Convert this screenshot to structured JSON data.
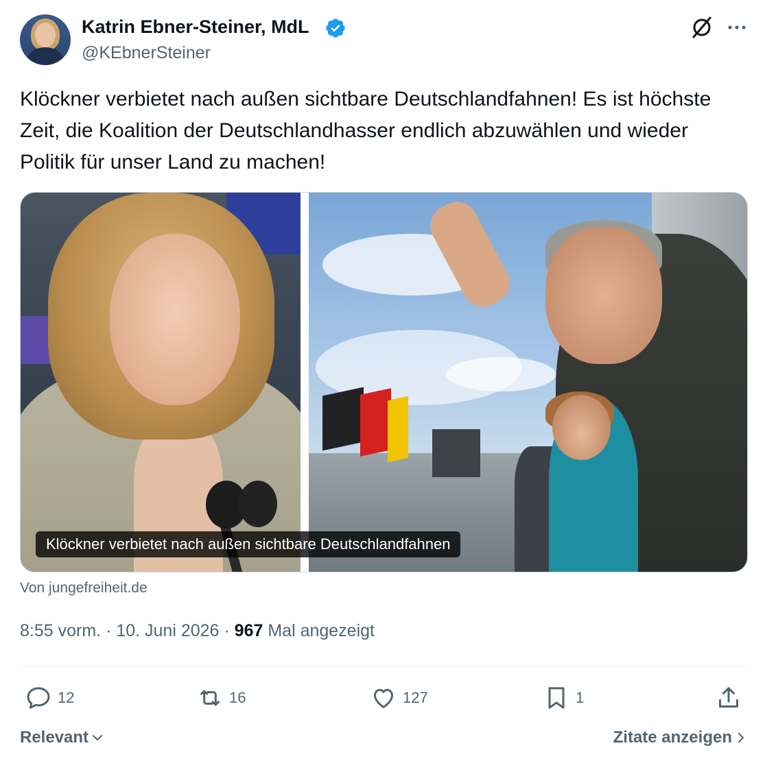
{
  "author": {
    "name": "Katrin Ebner-Steiner, MdL",
    "handle": "@KEbnerSteiner",
    "verified": true
  },
  "tweet": {
    "text": "Klöckner verbietet nach außen sichtbare Deutschlandfahnen! Es ist höchste Zeit, die Koalition der Deutschlandhasser endlich abzuwählen und wieder Politik für unser Land zu machen!"
  },
  "media": {
    "caption": "Klöckner verbietet nach außen sichtbare Deutschlandfahnen",
    "source": "Von jungefreiheit.de"
  },
  "meta": {
    "time": "8:55 vorm.",
    "separator": " · ",
    "date": "10. Juni 2026",
    "views_count": "967",
    "views_label": " Mal angezeigt"
  },
  "actions": {
    "replies": "12",
    "reposts": "16",
    "likes": "127",
    "bookmarks": "1"
  },
  "footer": {
    "sort_label": "Relevant",
    "quotes_label": "Zitate anzeigen"
  },
  "colors": {
    "primary_text": "#0f1419",
    "secondary_text": "#536471",
    "verified_blue": "#1d9bf0",
    "divider": "#eff3f4"
  },
  "icons": [
    "grok-icon",
    "more-icon",
    "verified-badge-icon",
    "reply-icon",
    "repost-icon",
    "like-icon",
    "bookmark-icon",
    "share-icon",
    "chevron-down-icon",
    "chevron-right-icon"
  ]
}
